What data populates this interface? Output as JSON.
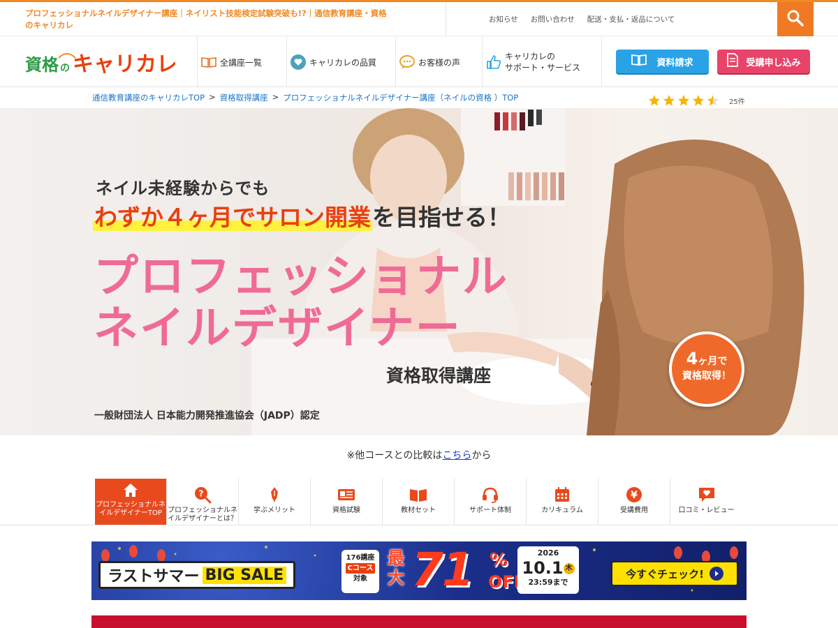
{
  "header": {
    "tagline": "プロフェッショナルネイルデザイナー講座｜ネイリスト技能検定試験突破も!?｜通信教育講座・資格のキャリカレ",
    "top_links": [
      "お知らせ",
      "お問い合わせ",
      "配送・支払・返品について"
    ],
    "accent_color": "#f08a24"
  },
  "nav": {
    "logo_text_a": "資格の",
    "logo_text_b": "キャリカレ",
    "items": [
      {
        "label": "全講座一覧",
        "icon": "book-icon"
      },
      {
        "label": "キャリカレの品質",
        "icon": "heart-icon"
      },
      {
        "label": "お客様の声",
        "icon": "speech-bubble-icon"
      },
      {
        "label_line1": "キャリカレの",
        "label_line2": "サポート・サービス",
        "icon": "thumbs-up-icon"
      }
    ],
    "request_label": "資料請求",
    "apply_label": "受講申し込み"
  },
  "breadcrumb": {
    "items": [
      "通信教育講座のキャリカレTOP",
      "資格取得講座",
      "プロフェッショナルネイルデザイナー講座（ネイルの資格 ）TOP"
    ],
    "separator": ">"
  },
  "rating": {
    "stars": 4.5,
    "count_label": "25件"
  },
  "hero": {
    "lead": "ネイル未経験からでも",
    "catch_highlight": "わずか４ヶ月でサロン開業",
    "catch_rest": "を目指せる！",
    "title_line1": "プロフェッショナル",
    "title_line2": "ネイルデザイナー",
    "subtitle": "資格取得講座",
    "certification": "一般財団法人 日本能力開発推進協会（JADP）認定",
    "badge_num": "4",
    "badge_unit": "ヶ月で",
    "badge_line2": "資格取得！"
  },
  "compare": {
    "prefix": "※他コースとの比較は",
    "link": "こちら",
    "suffix": "から"
  },
  "tabs": [
    {
      "label": "プロフェッショナルネイルデザイナーTOP",
      "icon": "home-icon",
      "active": true
    },
    {
      "label": "プロフェッショナルネイルデザイナーとは？",
      "icon": "question-icon",
      "active": false
    },
    {
      "label": "学ぶメリット",
      "icon": "pen-icon",
      "active": false
    },
    {
      "label": "資格試験",
      "icon": "id-card-icon",
      "active": false
    },
    {
      "label": "教材セット",
      "icon": "open-book-icon",
      "active": false
    },
    {
      "label": "サポート体制",
      "icon": "headset-icon",
      "active": false
    },
    {
      "label": "カリキュラム",
      "icon": "calendar-icon",
      "active": false
    },
    {
      "label": "受講費用",
      "icon": "yen-icon",
      "active": false
    },
    {
      "label": "口コミ・レビュー",
      "icon": "review-icon",
      "active": false
    }
  ],
  "sale_banner": {
    "title_a": "ラストサマー",
    "title_b": "BIG SALE",
    "target_count": "176講座",
    "target_course": "Cコース",
    "target_suffix": "対象",
    "max_label": "最大",
    "discount": "71",
    "percent": "%",
    "off": "OFF",
    "year": "2026",
    "date": "10.1",
    "weekday": "木",
    "time": "23:59まで",
    "cta": "今すぐチェック!"
  }
}
